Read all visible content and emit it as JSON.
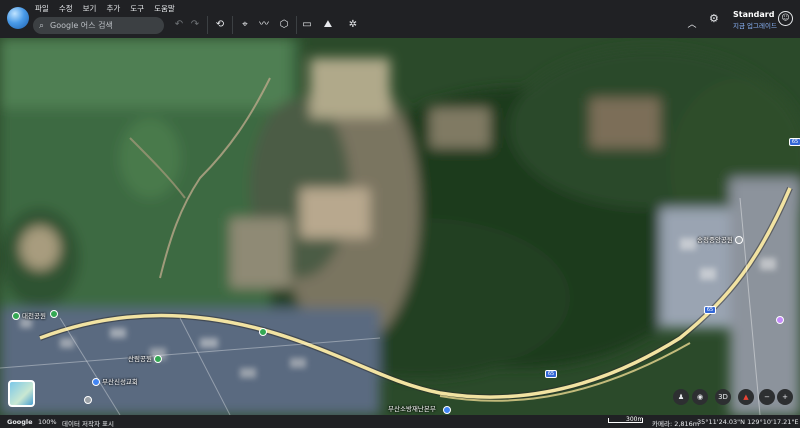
{
  "app": {
    "name": "Google Earth"
  },
  "menu": [
    "파일",
    "수정",
    "보기",
    "추가",
    "도구",
    "도움말"
  ],
  "search": {
    "placeholder": "Google 어스 검색"
  },
  "toolbar": {
    "icons": [
      "undo-icon",
      "redo-icon",
      "history-icon",
      "placemark-icon",
      "path-icon",
      "project-icon",
      "measure-icon",
      "layers-icon",
      "satellite-icon",
      "collapse-icon"
    ]
  },
  "account": {
    "plan_title": "Standard",
    "plan_action": "지금 업그레이드"
  },
  "map": {
    "labels": [
      {
        "text": "대천공원",
        "kind": "park"
      },
      {
        "text": "산림공원",
        "kind": "park"
      },
      {
        "text": "부산신성교회",
        "kind": "church"
      },
      {
        "text": "부산소방재난본부",
        "kind": "building"
      },
      {
        "text": "송정중앙공원",
        "kind": "park"
      }
    ],
    "route_shields": [
      "65",
      "65",
      "65"
    ]
  },
  "status": {
    "brand": "Google",
    "zoom": "100%",
    "attribution": "데이터 저작자 표시",
    "scale": "300m",
    "camera": "카메라: 2,816m",
    "coords": "35°11'24.03\"N 129°10'17.21\"E  250m"
  },
  "colors": {
    "chrome": "#202124",
    "search_bg": "#3c4043",
    "accent": "#8ab4f8",
    "road": "#f2e3a2"
  }
}
